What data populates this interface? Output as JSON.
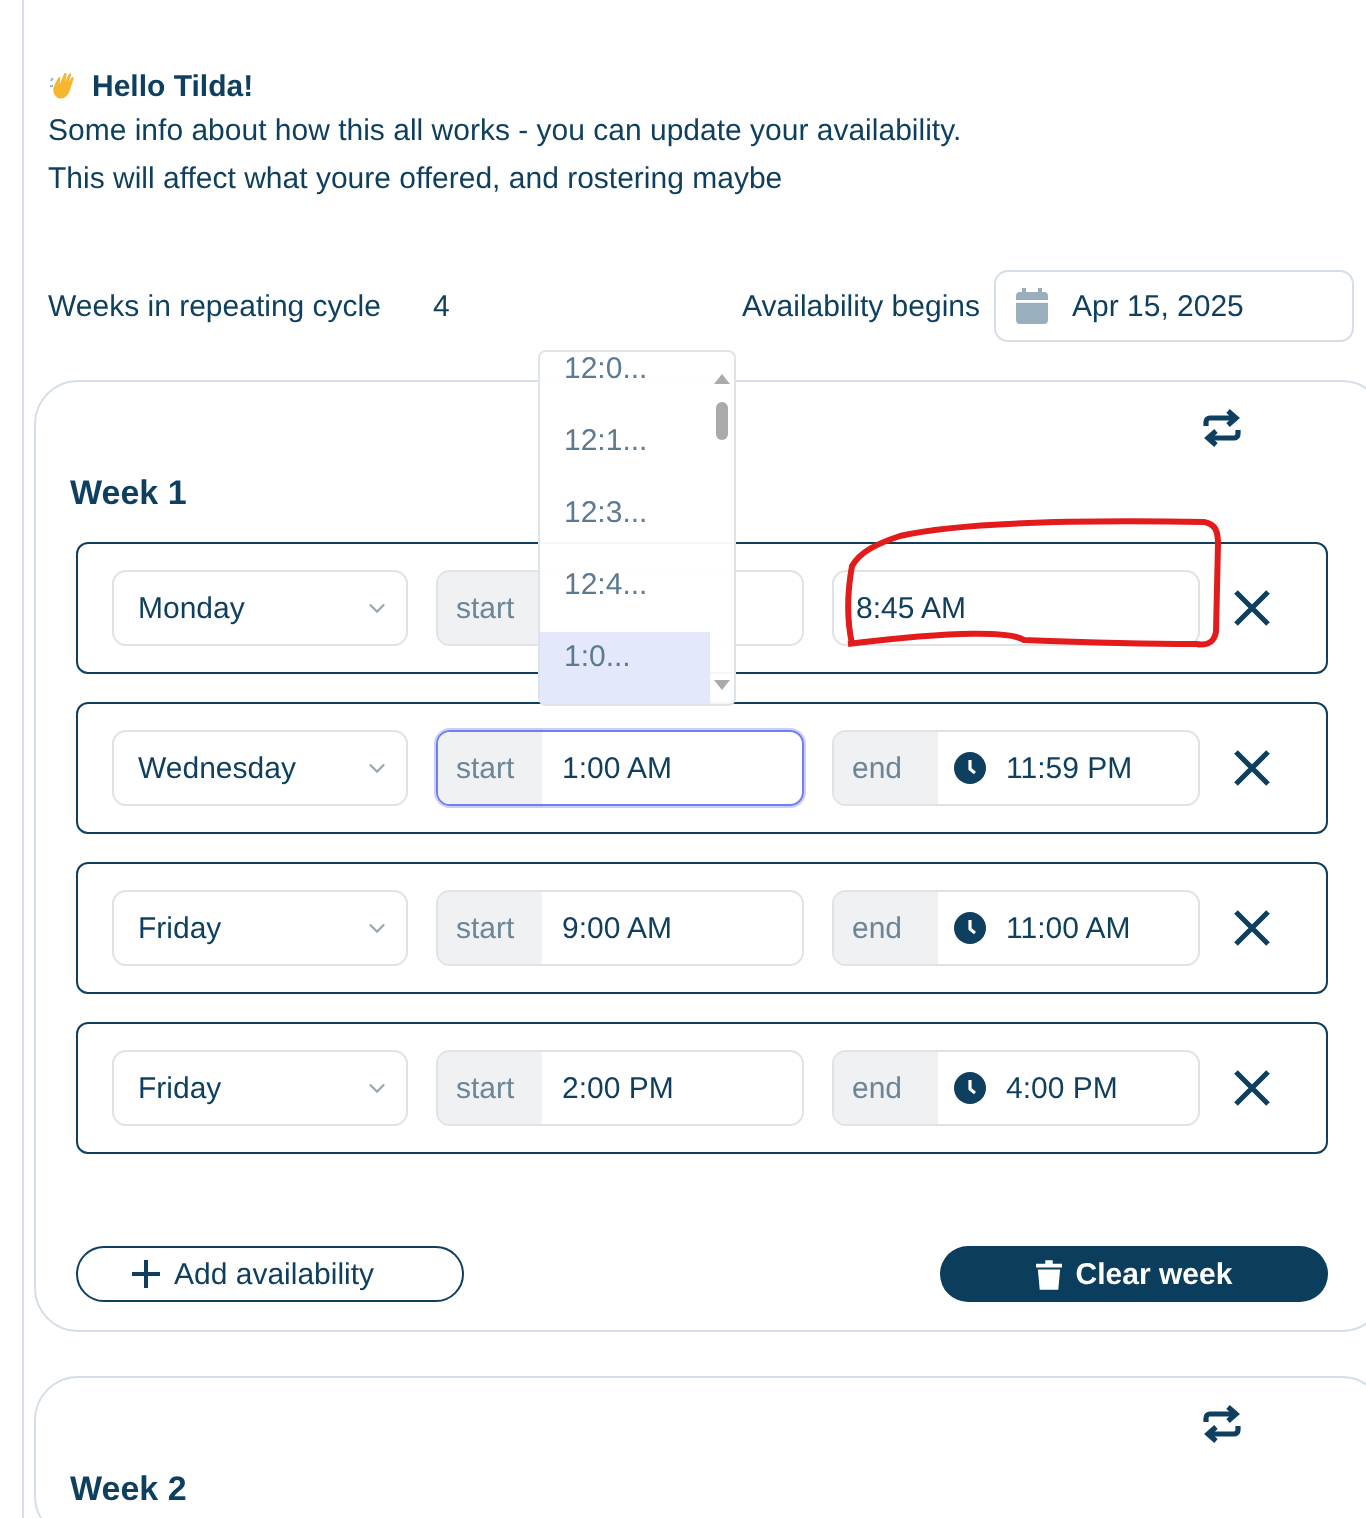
{
  "greeting": {
    "title": "Hello Tilda!"
  },
  "intro": [
    "Some info about how this all works - you can update your availability.",
    "This will affect what youre offered, and rostering maybe"
  ],
  "cycle": {
    "label": "Weeks in repeating cycle",
    "value": "4"
  },
  "begins": {
    "label": "Availability begins",
    "value": "Apr 15, 2025"
  },
  "weeks": [
    {
      "title": "Week 1",
      "slots": [
        {
          "day": "Monday",
          "start_label": "start",
          "end": "8:45 AM",
          "start_focused": false
        },
        {
          "day": "Wednesday",
          "start_label": "start",
          "start": "1:00 AM",
          "end_label": "end",
          "end": "11:59 PM",
          "start_focused": true
        },
        {
          "day": "Friday",
          "start_label": "start",
          "start": "9:00 AM",
          "end_label": "end",
          "end": "11:00 AM",
          "start_focused": false
        },
        {
          "day": "Friday",
          "start_label": "start",
          "start": "2:00 PM",
          "end_label": "end",
          "end": "4:00 PM",
          "start_focused": false
        }
      ],
      "add_label": "Add availability",
      "clear_label": "Clear week"
    },
    {
      "title": "Week 2"
    }
  ],
  "time_dropdown": {
    "options": [
      {
        "label": "12:0...",
        "selected": false
      },
      {
        "label": "12:1...",
        "selected": false
      },
      {
        "label": "12:3...",
        "selected": false
      },
      {
        "label": "12:4...",
        "selected": false
      },
      {
        "label": "1:0...",
        "selected": true
      }
    ]
  }
}
